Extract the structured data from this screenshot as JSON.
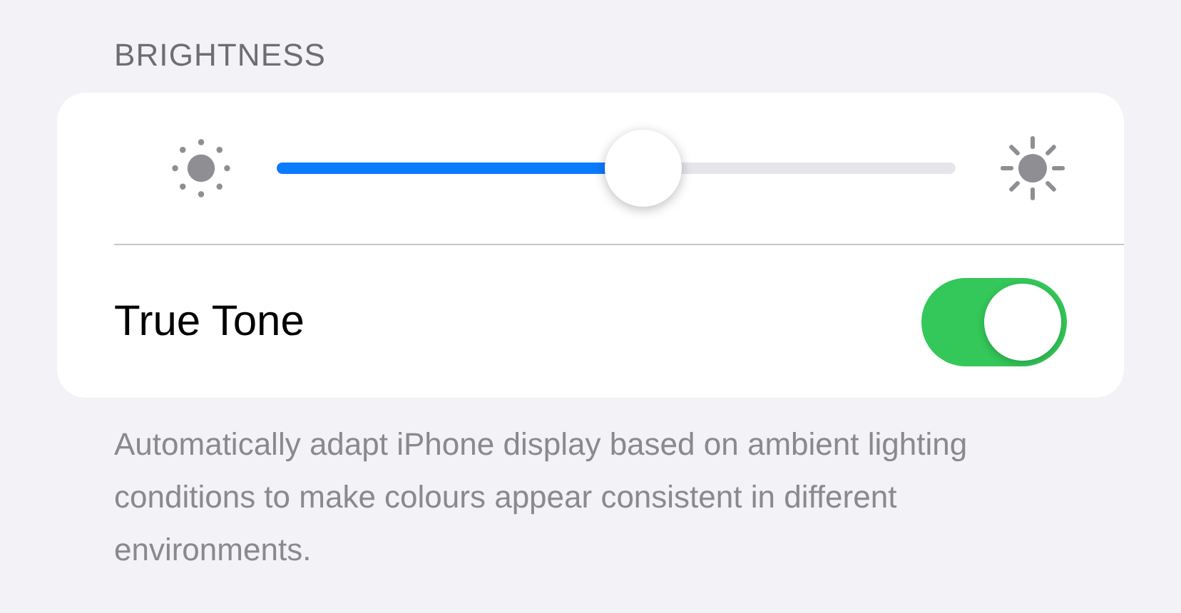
{
  "section_header": "BRIGHTNESS",
  "brightness": {
    "level": 0.54
  },
  "true_tone": {
    "label": "True Tone",
    "on": true
  },
  "footer": "Automatically adapt iPhone display based on ambient lighting conditions to make colours appear consistent in different environments."
}
